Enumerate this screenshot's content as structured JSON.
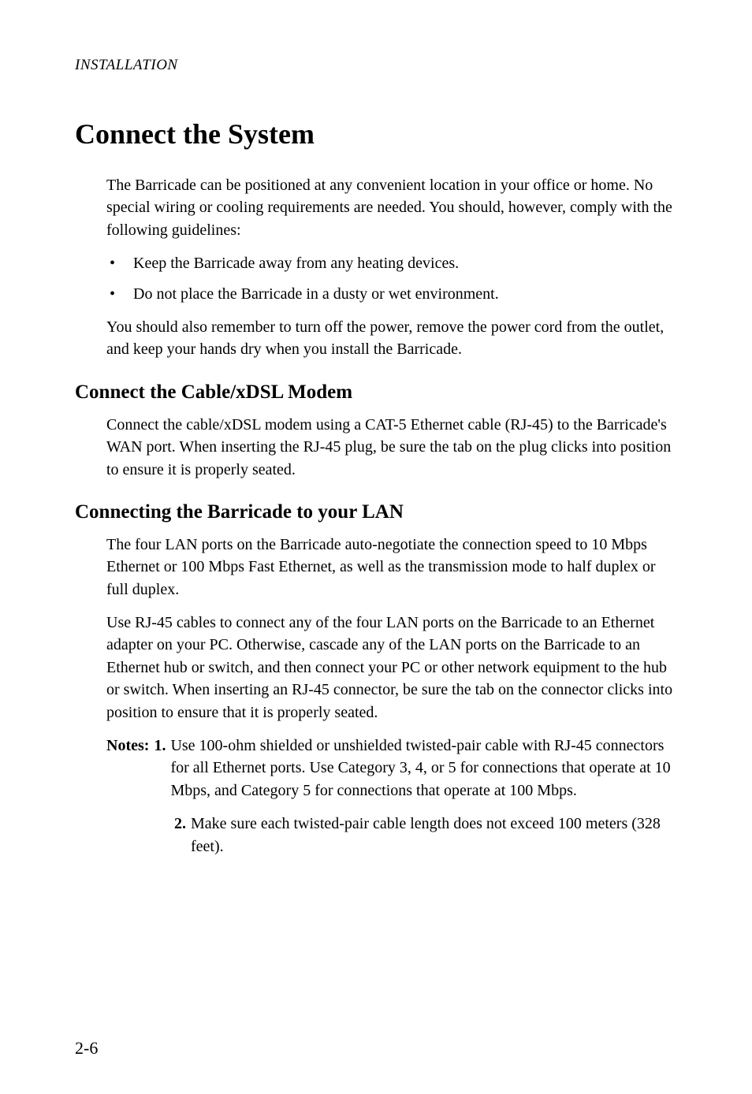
{
  "runningHeader": "INSTALLATION",
  "mainHeading": "Connect the System",
  "intro": "The Barricade can be positioned at any convenient location in your office or home. No special wiring or cooling requirements are needed. You should, however, comply with the following guidelines:",
  "bullets": [
    "Keep the Barricade away from any heating devices.",
    "Do not place the Barricade in a dusty or wet environment."
  ],
  "postBullets": "You should also remember to turn off the power, remove the power cord from the outlet, and keep your hands dry when you install the Barricade.",
  "section1": {
    "heading": "Connect the Cable/xDSL Modem",
    "para": "Connect the cable/xDSL modem using a CAT-5 Ethernet cable (RJ-45) to the Barricade's WAN port. When inserting the RJ-45 plug, be sure the tab on the plug clicks into position to ensure it is properly seated."
  },
  "section2": {
    "heading": "Connecting the Barricade to your LAN",
    "para1": "The four LAN ports on the Barricade auto-negotiate the connection speed to 10 Mbps Ethernet or 100 Mbps Fast Ethernet, as well as the transmission mode to half duplex or full duplex.",
    "para2": "Use RJ-45 cables to connect any of the four LAN ports on the Barricade to an Ethernet adapter on your PC. Otherwise, cascade any of the LAN ports on the Barricade to an Ethernet hub or switch, and then connect your PC or other network equipment to the hub or switch. When inserting an RJ-45 connector, be sure the tab on the connector clicks into position to ensure that it is properly seated."
  },
  "notes": {
    "label": "Notes:",
    "items": [
      {
        "num": "1.",
        "text": "Use 100-ohm shielded or unshielded twisted-pair cable with RJ-45 connectors for all Ethernet ports. Use Category 3, 4, or 5 for connections that operate at 10 Mbps, and Category 5 for connections that operate at 100 Mbps."
      },
      {
        "num": "2.",
        "text": "Make sure each twisted-pair cable length does not exceed 100 meters (328 feet)."
      }
    ]
  },
  "pageNumber": "2-6"
}
